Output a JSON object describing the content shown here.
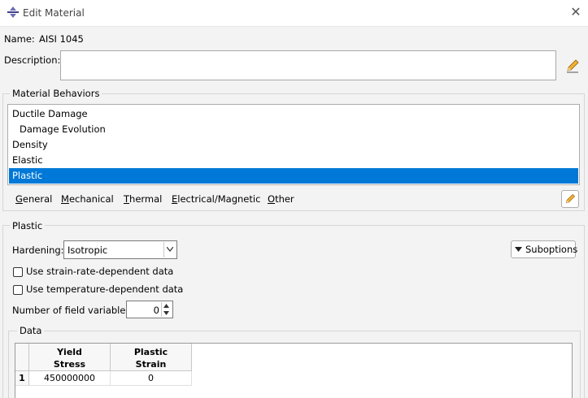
{
  "window": {
    "title": "Edit Material"
  },
  "material": {
    "name_label": "Name:",
    "name_value": "AISI 1045",
    "description_label": "Description:",
    "description_value": ""
  },
  "behaviors": {
    "group_title": "Material Behaviors",
    "items": [
      {
        "label": "Ductile Damage",
        "indent": 0,
        "selected": false
      },
      {
        "label": "Damage Evolution",
        "indent": 1,
        "selected": false
      },
      {
        "label": "Density",
        "indent": 0,
        "selected": false
      },
      {
        "label": "Elastic",
        "indent": 0,
        "selected": false
      },
      {
        "label": "Plastic",
        "indent": 0,
        "selected": true
      }
    ]
  },
  "menubar": {
    "items": [
      {
        "label": "General",
        "mnemonic": "G"
      },
      {
        "label": "Mechanical",
        "mnemonic": "M"
      },
      {
        "label": "Thermal",
        "mnemonic": "T"
      },
      {
        "label": "Electrical/Magnetic",
        "mnemonic": "E"
      },
      {
        "label": "Other",
        "mnemonic": "O"
      }
    ]
  },
  "plastic": {
    "group_title": "Plastic",
    "hardening_label": "Hardening:",
    "hardening_value": "Isotropic",
    "suboptions_label": "Suboptions",
    "strain_rate_label": "Use strain-rate-dependent data",
    "strain_rate_checked": false,
    "temperature_label": "Use temperature-dependent data",
    "temperature_checked": false,
    "field_vars_label": "Number of field variables:",
    "field_vars_value": "0"
  },
  "data_table": {
    "group_title": "Data",
    "columns": [
      {
        "line1": "Yield",
        "line2": "Stress"
      },
      {
        "line1": "Plastic",
        "line2": "Strain"
      }
    ],
    "rows": [
      {
        "index": "1",
        "cells": [
          "450000000",
          "0"
        ]
      }
    ]
  },
  "colors": {
    "selection": "#0078d7",
    "background": "#f3f3f3"
  }
}
